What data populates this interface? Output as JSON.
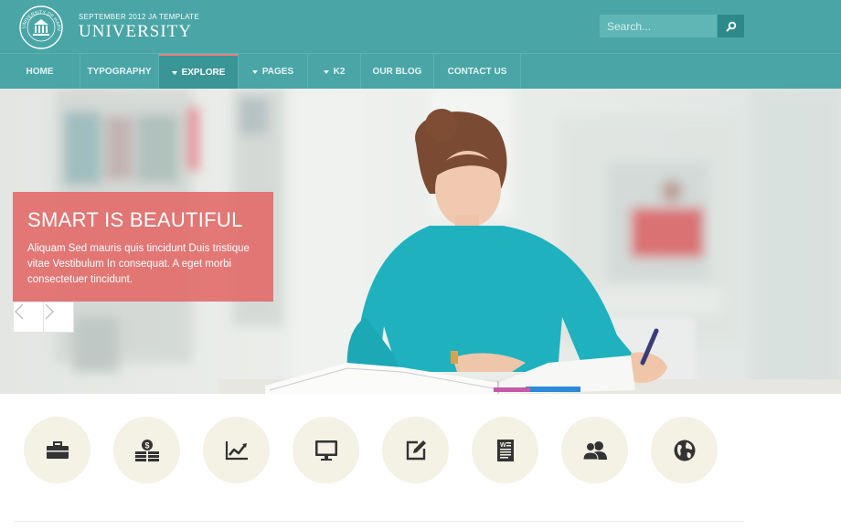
{
  "header": {
    "seal_text": "UNIVERSITY OF HARVERDE",
    "subtitle": "SEPTEMBER  2012 JA TEMPLATE",
    "title": "UNIVERSITY",
    "search": {
      "placeholder": "Search...",
      "icon": "search-icon"
    }
  },
  "nav": {
    "items": [
      {
        "label": "HOME",
        "dropdown": false,
        "active": false
      },
      {
        "label": "TYPOGRAPHY",
        "dropdown": false,
        "active": false
      },
      {
        "label": "EXPLORE",
        "dropdown": true,
        "active": true
      },
      {
        "label": "PAGES",
        "dropdown": true,
        "active": false
      },
      {
        "label": "K2",
        "dropdown": true,
        "active": false
      },
      {
        "label": "OUR BLOG",
        "dropdown": false,
        "active": false
      },
      {
        "label": "CONTACT US",
        "dropdown": false,
        "active": false
      }
    ]
  },
  "slider": {
    "title": "SMART IS BEAUTIFUL",
    "text": "Aliquam Sed mauris quis tincidunt Duis tristique vitae Vestibulum In consequat. A eget morbi consectetuer tincidunt.",
    "prev_icon": "chevron-left-icon",
    "next_icon": "chevron-right-icon"
  },
  "features": {
    "icons": [
      "briefcase-icon",
      "money-icon",
      "chart-icon",
      "monitor-icon",
      "edit-icon",
      "document-icon",
      "users-icon",
      "globe-icon"
    ]
  },
  "colors": {
    "teal": "#4aa5a6",
    "nav_active": "#3a9596",
    "accent": "#e26e6c",
    "feature_bg": "#f4f1e5",
    "icon": "#333333"
  }
}
